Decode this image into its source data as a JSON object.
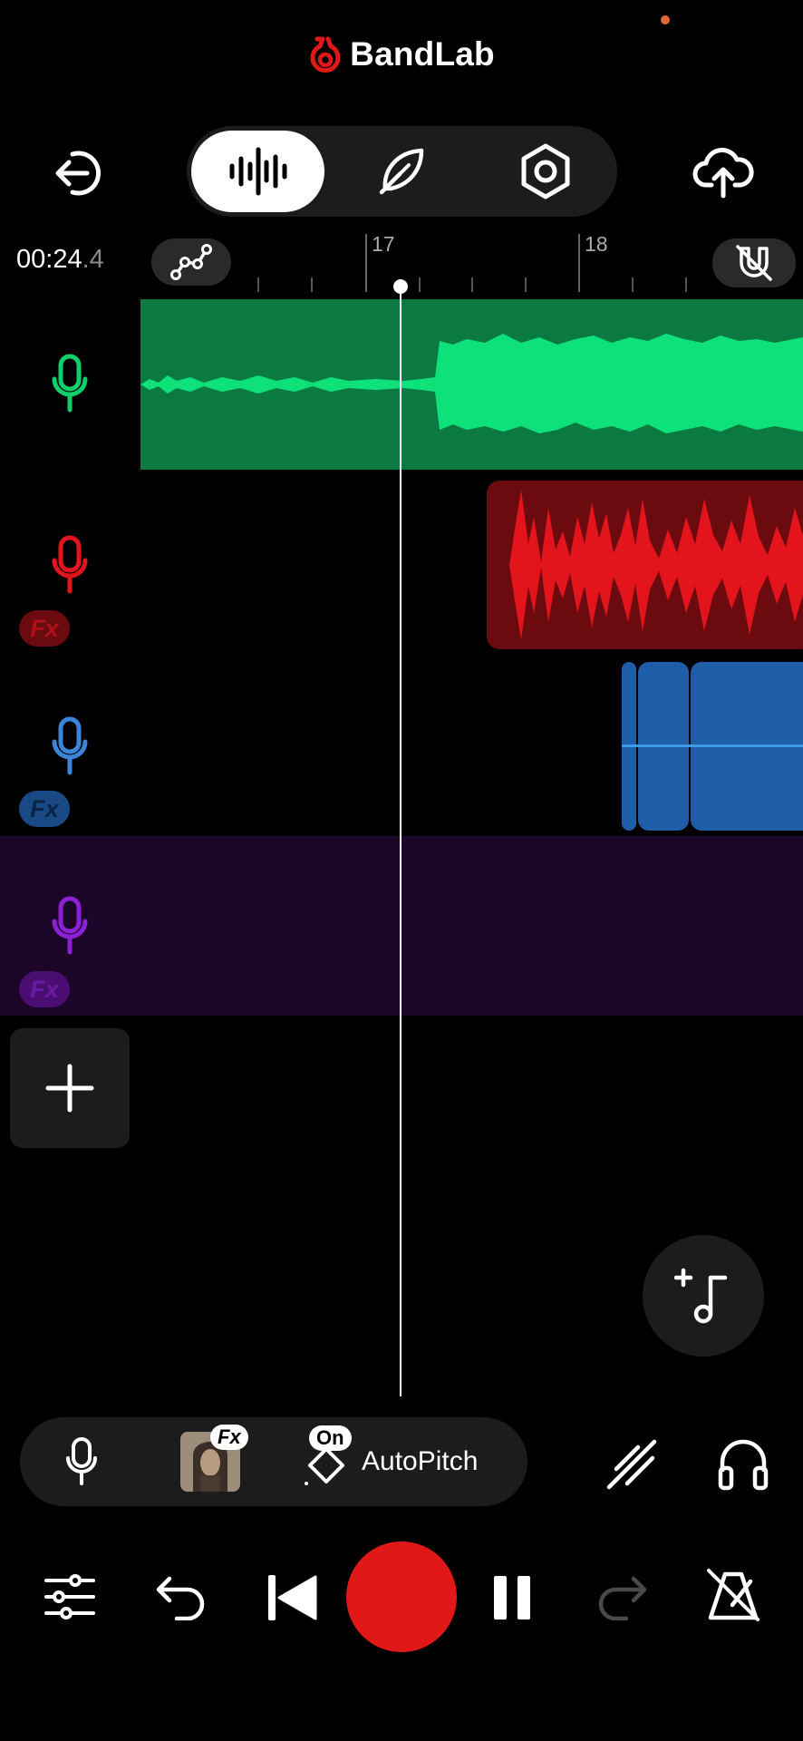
{
  "app": {
    "title": "BandLab"
  },
  "colors": {
    "accent_red": "#e01818",
    "green_track": "#0ecf6a",
    "red_track": "#e3141c",
    "blue_track": "#3b85d9",
    "purple_track": "#8b20d4"
  },
  "header": {
    "exit_icon": "exit-icon",
    "tabs": [
      {
        "name": "waveform-tab",
        "icon": "waveform-icon",
        "active": true
      },
      {
        "name": "lyrics-tab",
        "icon": "feather-icon",
        "active": false
      },
      {
        "name": "settings-tab",
        "icon": "hex-nut-icon",
        "active": false
      }
    ],
    "upload_icon": "cloud-upload-icon"
  },
  "timeline": {
    "time_main": "00:24",
    "time_fraction": ".4",
    "ruler_labels": [
      "17",
      "18"
    ]
  },
  "tracks": [
    {
      "name": "track-1",
      "color": "#0ecf6a",
      "fx": false
    },
    {
      "name": "track-2",
      "color": "#e3141c",
      "fx": true,
      "fx_label": "Fx"
    },
    {
      "name": "track-3",
      "color": "#3b85d9",
      "fx": true,
      "fx_label": "Fx"
    },
    {
      "name": "track-4",
      "color": "#8b20d4",
      "fx": true,
      "fx_label": "Fx",
      "selected": true
    }
  ],
  "bottom_bar": {
    "fx_label": "Fx",
    "on_label": "On",
    "autopitch_label": "AutoPitch"
  }
}
